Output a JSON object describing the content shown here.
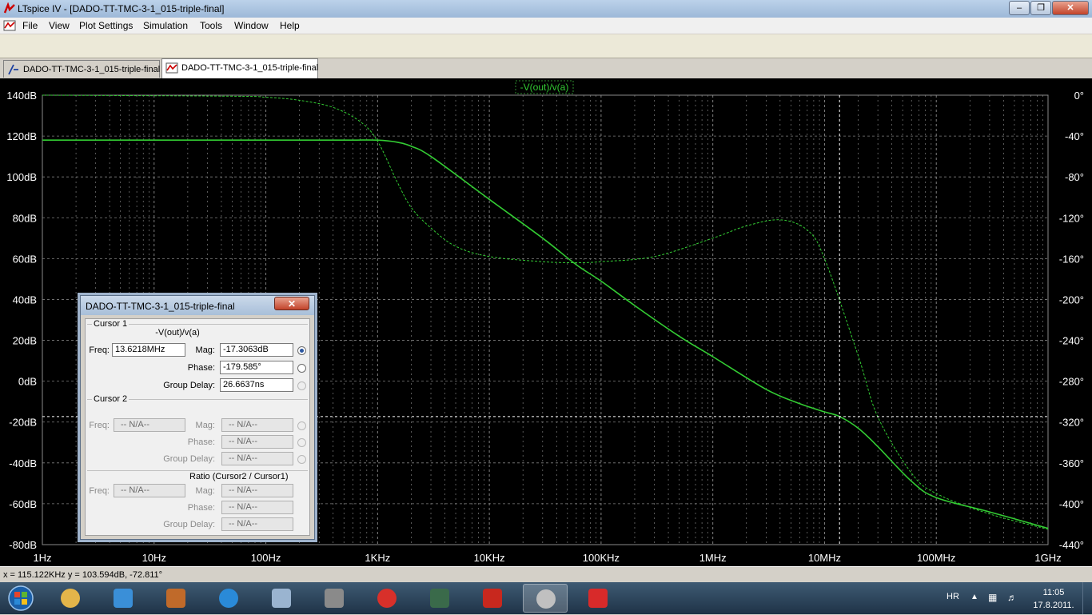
{
  "window": {
    "title": "LTspice IV - [DADO-TT-TMC-3-1_015-triple-final]",
    "controls": {
      "minimize": "–",
      "restore": "❐",
      "close": "✕"
    },
    "mdi_controls": {
      "minimize": "–",
      "restore": "❐",
      "close": "✕"
    }
  },
  "menu": [
    "File",
    "View",
    "Plot Settings",
    "Simulation",
    "Tools",
    "Window",
    "Help"
  ],
  "toolbar_icons": [
    "new-schematic-icon",
    "open-icon",
    "save-icon",
    "control-panel-icon",
    "run-icon",
    "halt-icon",
    "zoom-in-icon",
    "zoom-box-icon",
    "zoom-out-icon",
    "zoom-cancel-icon",
    "autorange-icon",
    "fit-icon",
    "tile-horizontal-icon",
    "cascade-icon",
    "tile-vertical-icon",
    "cut-icon",
    "copy-icon",
    "paste-icon",
    "find-icon",
    "print-setup-icon",
    "print-icon",
    "wire-icon",
    "ground-icon",
    "label-icon",
    "resistor-icon",
    "capacitor-icon",
    "inductor-icon",
    "diode-icon",
    "component-icon",
    "move-icon",
    "drag-icon",
    "undo-icon",
    "redo-icon",
    "rotate-icon",
    "mirror-icon",
    "text-icon",
    "spice-directive-icon"
  ],
  "tabs": [
    {
      "label": "DADO-TT-TMC-3-1_015-triple-final",
      "icon": "schematic-icon",
      "active": false
    },
    {
      "label": "DADO-TT-TMC-3-1_015-triple-final",
      "icon": "waveform-icon",
      "active": true
    }
  ],
  "plot": {
    "trace_label": "-V(out)/v(a)",
    "trace_color": "#33cc33",
    "background": "#000000",
    "grid_color": "#7f7f7f",
    "left_ticks": [
      "140dB",
      "120dB",
      "100dB",
      "80dB",
      "60dB",
      "40dB",
      "20dB",
      "0dB",
      "-20dB",
      "-40dB",
      "-60dB",
      "-80dB"
    ],
    "right_ticks": [
      "0°",
      "-40°",
      "-80°",
      "-120°",
      "-160°",
      "-200°",
      "-240°",
      "-280°",
      "-320°",
      "-360°",
      "-400°",
      "-440°"
    ],
    "x_ticks": [
      "1Hz",
      "10Hz",
      "100Hz",
      "1KHz",
      "10KHz",
      "100KHz",
      "1MHz",
      "10MHz",
      "100MHz",
      "1GHz"
    ],
    "cursor": {
      "freq_hz": 13621800,
      "mag_db": -17.3063
    }
  },
  "chart_data": {
    "type": "line",
    "x_scale": "log",
    "xlim": [
      1,
      1000000000
    ],
    "ylim_left": [
      -80,
      140
    ],
    "ylim_right": [
      -440,
      0
    ],
    "grid": true,
    "series": [
      {
        "name": "-V(out)/v(a)",
        "axis": "left",
        "style": "solid",
        "x": [
          1,
          100,
          300,
          600,
          1000,
          1500,
          2000,
          3000,
          10000,
          30000,
          60000,
          100000,
          200000,
          500000,
          1000000,
          3000000,
          6000000,
          10000000,
          13621800,
          20000000,
          30000000,
          60000000,
          100000000,
          300000000,
          1000000000
        ],
        "y": [
          118,
          118,
          118,
          118,
          118,
          117,
          115,
          110,
          89,
          70,
          57,
          49,
          37,
          22,
          12,
          -4,
          -11,
          -15,
          -17.3,
          -23,
          -32,
          -49,
          -57,
          -64,
          -72
        ]
      },
      {
        "name": "phase",
        "axis": "right",
        "style": "dashed",
        "x": [
          1,
          50,
          100,
          200,
          400,
          700,
          1000,
          1500,
          2000,
          3000,
          5000,
          10000,
          30000,
          60000,
          100000,
          300000,
          1000000,
          2000000,
          4000000,
          7000000,
          10000000,
          20000000,
          30000000,
          60000000,
          100000000,
          300000000,
          1000000000
        ],
        "y": [
          0,
          -1,
          -2,
          -5,
          -12,
          -26,
          -45,
          -85,
          -110,
          -130,
          -148,
          -158,
          -163,
          -164,
          -163,
          -158,
          -140,
          -128,
          -122,
          -132,
          -160,
          -255,
          -315,
          -370,
          -390,
          -410,
          -425
        ]
      }
    ]
  },
  "cursor_dialog": {
    "title": "DADO-TT-TMC-3-1_015-triple-final",
    "close": "✕",
    "cursor1": {
      "group": "Cursor 1",
      "trace": "-V(out)/v(a)",
      "freq_label": "Freq:",
      "freq": "13.6218MHz",
      "mag_label": "Mag:",
      "mag": "-17.3063dB",
      "phase_label": "Phase:",
      "phase": "-179.585°",
      "gd_label": "Group Delay:",
      "gd": "26.6637ns"
    },
    "cursor2": {
      "group": "Cursor 2",
      "freq_label": "Freq:",
      "freq": "-- N/A--",
      "mag_label": "Mag:",
      "mag": "-- N/A--",
      "phase_label": "Phase:",
      "phase": "-- N/A--",
      "gd_label": "Group Delay:",
      "gd": "-- N/A--"
    },
    "ratio": {
      "group": "Ratio (Cursor2 / Cursor1)",
      "freq_label": "Freq:",
      "freq": "-- N/A--",
      "mag_label": "Mag:",
      "mag": "-- N/A--",
      "phase_label": "Phase:",
      "phase": "-- N/A--",
      "gd_label": "Group Delay:",
      "gd": "-- N/A--"
    }
  },
  "status": "x = 115.122KHz   y = 103.594dB, -72.811°",
  "taskbar": {
    "items": [
      "start-orb-icon",
      "explorer-icon",
      "media-player-icon",
      "installer-icon",
      "internet-explorer-icon",
      "images-icon",
      "network-icon",
      "security-icon",
      "oscilloscope-icon",
      "pdf-reader-icon",
      "ltspice-icon",
      "paint-splat-icon"
    ],
    "active_index": 10,
    "tray_lang": "HR",
    "tray_arrow": "▲",
    "time": "11:05",
    "date": "17.8.2011."
  }
}
